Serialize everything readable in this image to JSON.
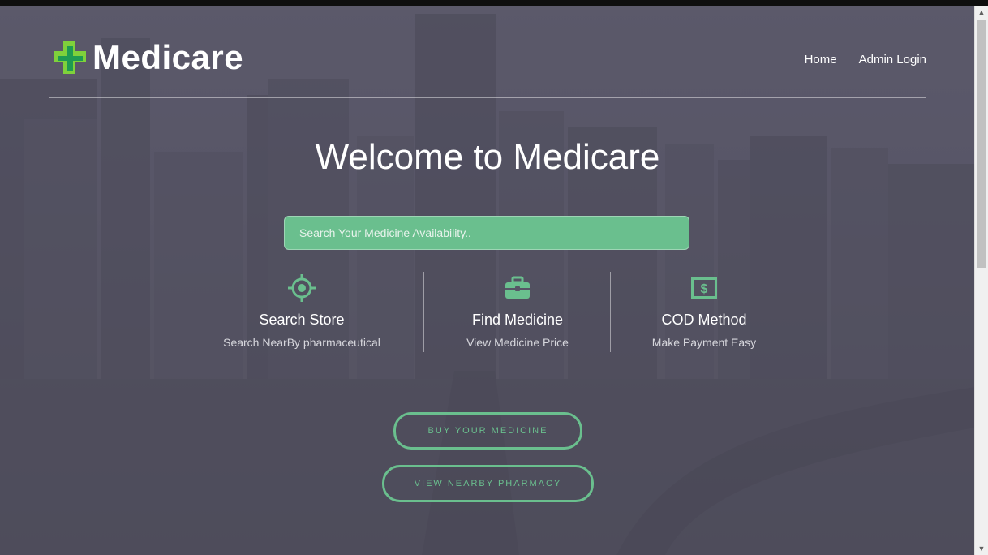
{
  "brand": {
    "name": "Medicare"
  },
  "nav": {
    "home": "Home",
    "admin_login": "Admin Login"
  },
  "hero": {
    "title": "Welcome to Medicare"
  },
  "search": {
    "placeholder": "Search Your Medicine Availability.."
  },
  "features": [
    {
      "icon": "crosshair-icon",
      "title": "Search Store",
      "subtitle": "Search NearBy pharmaceutical"
    },
    {
      "icon": "briefcase-icon",
      "title": "Find Medicine",
      "subtitle": "View Medicine Price"
    },
    {
      "icon": "money-icon",
      "title": "COD Method",
      "subtitle": "Make Payment Easy"
    }
  ],
  "buttons": {
    "buy": "BUY YOUR MEDICINE",
    "nearby": "VIEW NEARBY PHARMACY"
  },
  "colors": {
    "accent": "#6abf8e",
    "overlay": "#5a5868"
  }
}
